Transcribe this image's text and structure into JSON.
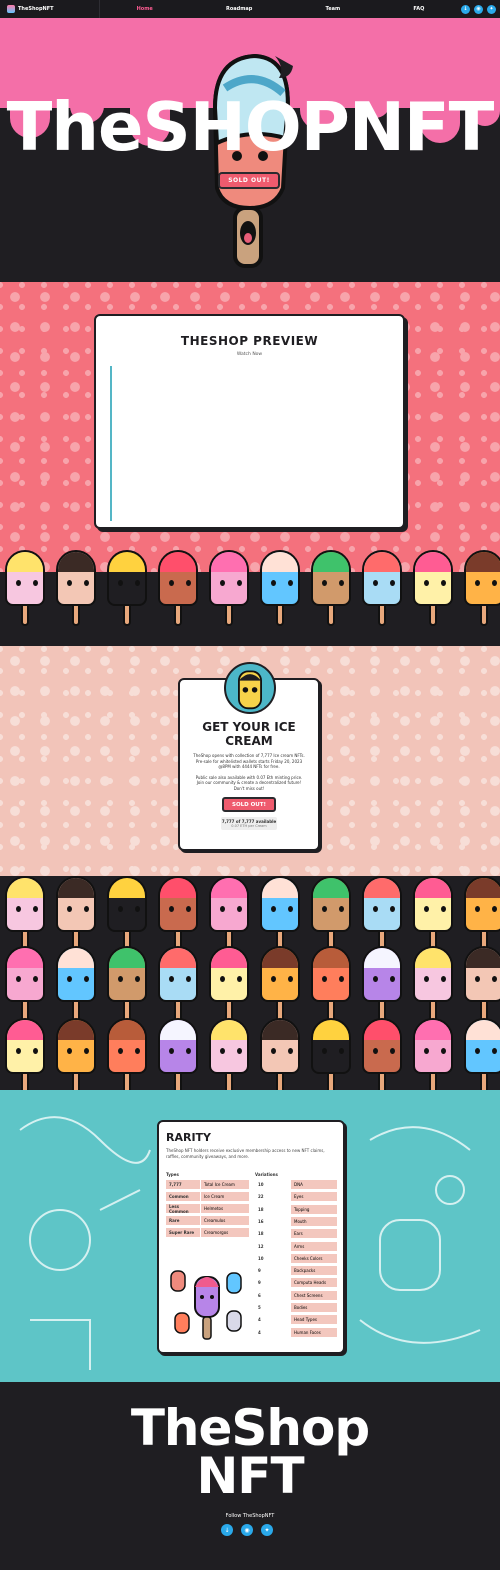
{
  "nav": {
    "brand": "TheShopNFT",
    "links": [
      {
        "label": "Home",
        "active": true
      },
      {
        "label": "Roadmap",
        "active": false
      },
      {
        "label": "Team",
        "active": false
      },
      {
        "label": "FAQ",
        "active": false
      }
    ],
    "social_icons": [
      "download-icon",
      "discord-icon",
      "twitter-icon"
    ]
  },
  "hero": {
    "title": "TheSHOPNFT",
    "button": "SOLD OUT!"
  },
  "preview": {
    "title": "THESHOP PREVIEW",
    "subtitle": "Watch Now"
  },
  "mint": {
    "title_line1": "GET YOUR ICE",
    "title_line2": "CREAM",
    "text1": "TheShop opens with collection of 7,777 Ice cream NFTs. Pre-sale for whitelisted wallets starts Friday 20, 2023 @8PM with 4444 NFTs for free.",
    "text2": "Public sale also available with 0.07 Eth minting price. Join our community & create a decentralized future! Don't miss out!",
    "button": "SOLD OUT!",
    "available": "7,777 of 7,777 available",
    "price": "0.07 ETH per Cream"
  },
  "rarity": {
    "title": "RARITY",
    "text": "TheShop NFT holders receive exclusive membership access to new NFT claims, raffles, community giveaways, and more.",
    "types_header": "Types",
    "variations_header": "Variations",
    "types": [
      {
        "count": "7,777",
        "name": "Total Ice Cream"
      },
      {
        "count": "Common",
        "name": "Ice Cream"
      },
      {
        "count": "Less Common",
        "name": "Helmetos"
      },
      {
        "count": "Rare",
        "name": "Creamulos"
      },
      {
        "count": "Super Rare",
        "name": "Creamorgos"
      }
    ],
    "variations": [
      {
        "count": "10",
        "name": "DNA"
      },
      {
        "count": "22",
        "name": "Eyes"
      },
      {
        "count": "18",
        "name": "Topping"
      },
      {
        "count": "16",
        "name": "Mouth"
      },
      {
        "count": "18",
        "name": "Ears"
      },
      {
        "count": "12",
        "name": "Arms"
      },
      {
        "count": "10",
        "name": "Cheeks Colors"
      },
      {
        "count": "9",
        "name": "Backpacks"
      },
      {
        "count": "9",
        "name": "Computa Heads"
      },
      {
        "count": "6",
        "name": "Chest Screens"
      },
      {
        "count": "5",
        "name": "Bodies"
      },
      {
        "count": "4",
        "name": "Head Types"
      },
      {
        "count": "4",
        "name": "Human Faces"
      }
    ]
  },
  "footer": {
    "title_line1": "TheShop",
    "title_line2": "NFT",
    "follow": "Follow TheShopNFT"
  },
  "colors": {
    "accent_pink": "#ff5c93",
    "button_red": "#ef5b6e",
    "preview_bg": "#f4717d",
    "mint_bg": "#f2c4b9",
    "rarity_bg": "#5ec5c7",
    "dark_bg": "#1f1e22"
  }
}
